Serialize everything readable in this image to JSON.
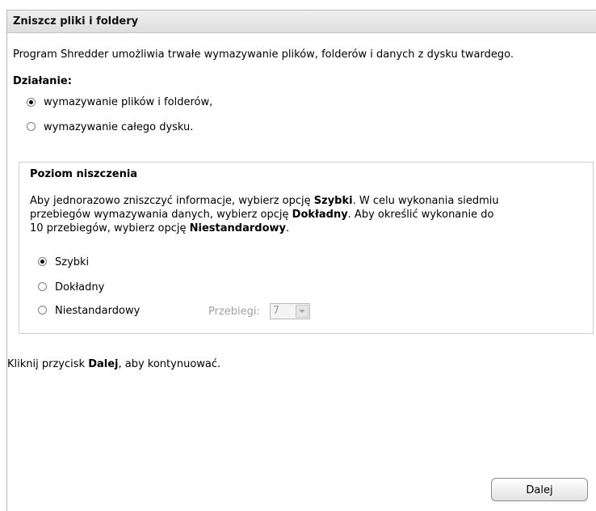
{
  "header": {
    "title": "Zniszcz pliki i foldery"
  },
  "intro": "Program Shredder umożliwia trwałe wymazywanie plików, folderów i danych z dysku twardego.",
  "action": {
    "label": "Działanie:",
    "options": [
      {
        "label": "wymazywanie plików i folderów,",
        "checked": true
      },
      {
        "label": "wymazywanie całego dysku.",
        "checked": false
      }
    ]
  },
  "level": {
    "title": "Poziom niszczenia",
    "desc": {
      "p1": "Aby jednorazowo zniszczyć informacje, wybierz opcję ",
      "b1": "Szybki",
      "p2": ". W celu wykonania siedmiu",
      "p3": "przebiegów wymazywania danych, wybierz opcję ",
      "b2": "Dokładny",
      "p4": ". Aby określić wykonanie do",
      "p5": "10 przebiegów, wybierz opcję ",
      "b3": "Niestandardowy",
      "p6": "."
    },
    "options": [
      {
        "label": "Szybki",
        "checked": true
      },
      {
        "label": "Dokładny",
        "checked": false
      },
      {
        "label": "Niestandardowy",
        "checked": false
      }
    ],
    "passes_label": "Przebiegi:",
    "passes_value": "7"
  },
  "footer": {
    "pre": "Kliknij przycisk ",
    "bold": "Dalej",
    "post": ", aby kontynuować."
  },
  "next_label": "Dalej"
}
